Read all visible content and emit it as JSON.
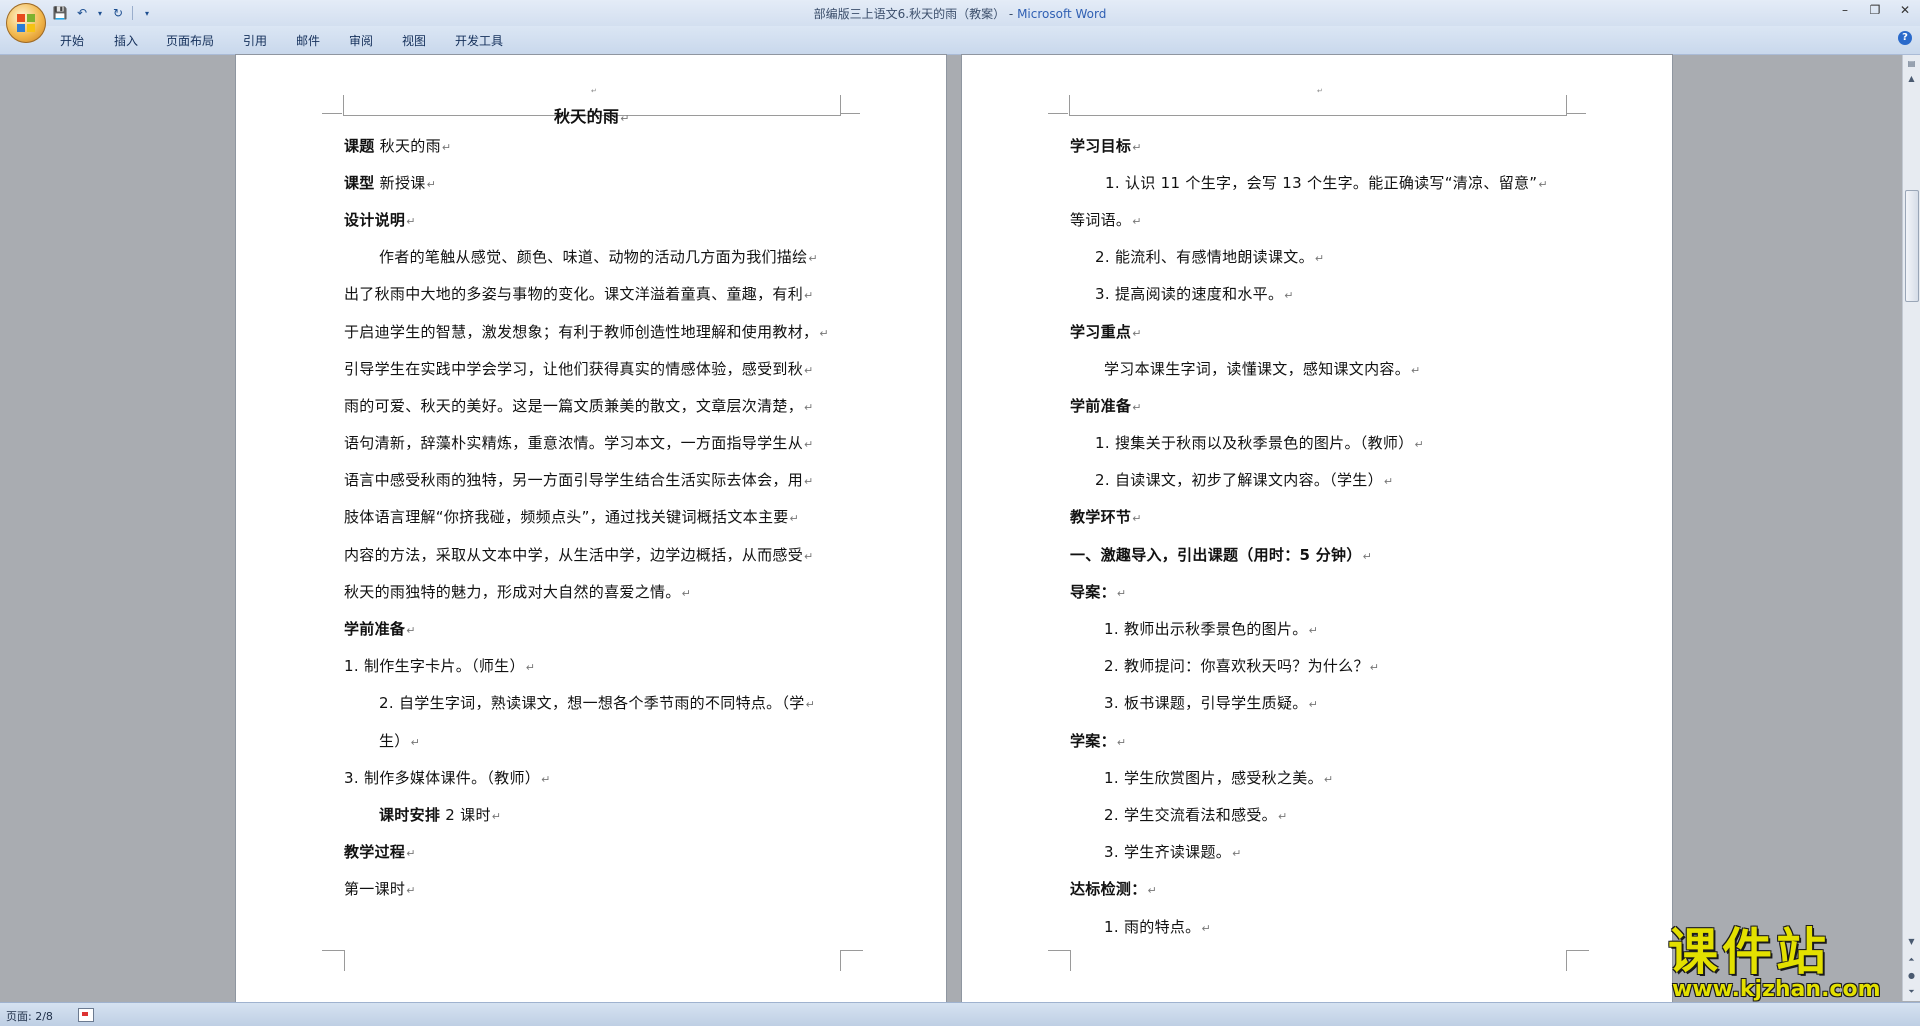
{
  "window": {
    "title": "部编版三上语文6.秋天的雨（教案）",
    "app_name": "Microsoft Word"
  },
  "ribbon": {
    "tabs": [
      "开始",
      "插入",
      "页面布局",
      "引用",
      "邮件",
      "审阅",
      "视图",
      "开发工具"
    ]
  },
  "status": {
    "page_indicator": "页面: 2/8"
  },
  "paragraph_mark": "↵",
  "page_left": {
    "title": "秋天的雨",
    "lines": [
      {
        "label": "课题",
        "text": " 秋天的雨"
      },
      {
        "label": "课型",
        "text": " 新授课"
      },
      {
        "label": "设计说明",
        "text": ""
      },
      {
        "label": "",
        "text": "作者的笔触从感觉、颜色、味道、动物的活动几方面为我们描绘"
      },
      {
        "label": "",
        "text": "出了秋雨中大地的多姿与事物的变化。课文洋溢着童真、童趣，有利"
      },
      {
        "label": "",
        "text": "于启迪学生的智慧，激发想象；有利于教师创造性地理解和使用教材，"
      },
      {
        "label": "",
        "text": "引导学生在实践中学会学习，让他们获得真实的情感体验，感受到秋"
      },
      {
        "label": "",
        "text": "雨的可爱、秋天的美好。这是一篇文质兼美的散文，文章层次清楚，"
      },
      {
        "label": "",
        "text": "语句清新，辞藻朴实精炼，重意浓情。学习本文，一方面指导学生从"
      },
      {
        "label": "",
        "text": "语言中感受秋雨的独特，另一方面引导学生结合生活实际去体会，用"
      },
      {
        "label": "",
        "text": "肢体语言理解“你挤我碰，频频点头”，通过找关键词概括文本主要"
      },
      {
        "label": "",
        "text": "内容的方法，采取从文本中学，从生活中学，边学边概括，从而感受"
      },
      {
        "label": "",
        "text": "秋天的雨独特的魅力，形成对大自然的喜爱之情。"
      },
      {
        "label": "学前准备",
        "text": ""
      },
      {
        "label": "",
        "text": "1. 制作生字卡片。（师生）"
      },
      {
        "label": "",
        "text": "2. 自学生字词，熟读课文，想一想各个季节雨的不同特点。（学"
      },
      {
        "label": "",
        "text": "生）"
      },
      {
        "label": "",
        "text": "3. 制作多媒体课件。（教师）"
      },
      {
        "label": "课时安排",
        "text": " 2 课时"
      },
      {
        "label": "教学过程",
        "text": ""
      },
      {
        "label": "",
        "text": "第一课时"
      }
    ]
  },
  "page_right": {
    "lines": [
      {
        "label": "学习目标",
        "text": ""
      },
      {
        "label": "",
        "text": "1. 认识 11 个生字，会写 13 个生字。能正确读写“清凉、留意”"
      },
      {
        "label": "",
        "text": "等词语。"
      },
      {
        "label": "",
        "text": "2. 能流利、有感情地朗读课文。"
      },
      {
        "label": "",
        "text": "3. 提高阅读的速度和水平。"
      },
      {
        "label": "学习重点",
        "text": ""
      },
      {
        "label": "",
        "text": "学习本课生字词，读懂课文，感知课文内容。"
      },
      {
        "label": "学前准备",
        "text": ""
      },
      {
        "label": "",
        "text": "1. 搜集关于秋雨以及秋季景色的图片。（教师）"
      },
      {
        "label": "",
        "text": "2. 自读课文，初步了解课文内容。（学生）"
      },
      {
        "label": "教学环节",
        "text": ""
      },
      {
        "label": "一、激趣导入，引出课题（用时：5 分钟）",
        "text": ""
      },
      {
        "label": "导案：",
        "text": ""
      },
      {
        "label": "",
        "text": "1. 教师出示秋季景色的图片。"
      },
      {
        "label": "",
        "text": "2. 教师提问：你喜欢秋天吗？为什么？"
      },
      {
        "label": "",
        "text": "3. 板书课题，引导学生质疑。"
      },
      {
        "label": "学案：",
        "text": ""
      },
      {
        "label": "",
        "text": "1. 学生欣赏图片，感受秋之美。"
      },
      {
        "label": "",
        "text": "2. 学生交流看法和感受。"
      },
      {
        "label": "",
        "text": "3. 学生齐读课题。"
      },
      {
        "label": "达标检测：",
        "text": ""
      },
      {
        "label": "",
        "text": "1. 雨的特点。"
      }
    ]
  },
  "watermark": {
    "title": "课件站",
    "url": "www.kjzhan.com"
  }
}
